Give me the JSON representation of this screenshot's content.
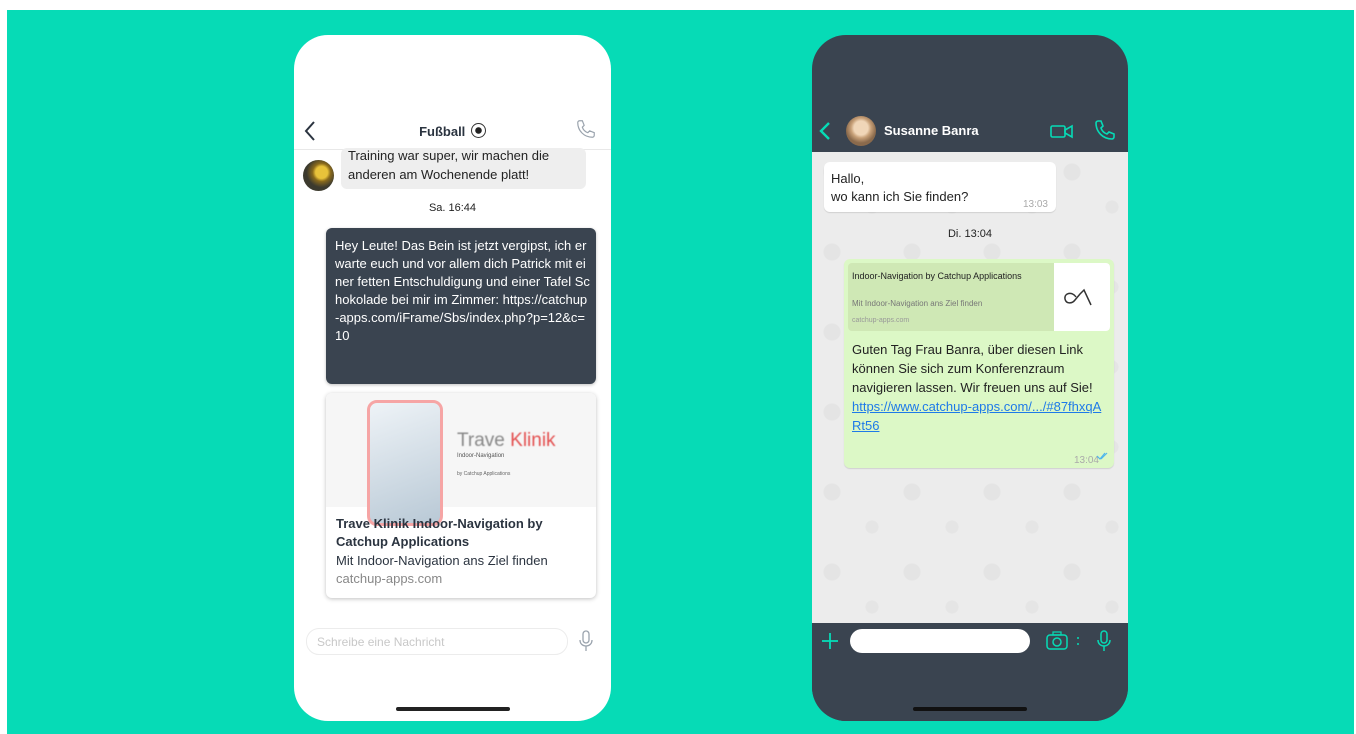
{
  "colors": {
    "background": "#06dbb6",
    "accent": "#06dbb6",
    "dark_bubble": "#3a4450",
    "link": "#1e7ae8"
  },
  "left_phone": {
    "chat_title": "Fußball",
    "incoming_message": "Training war super, wir machen die anderen am Wochenende platt!",
    "timestamp": "Sa. 16:44",
    "outgoing_message": "Hey Leute! Das Bein ist jetzt vergipst, ich erwarte euch und vor allem dich Patrick mit einer fetten Entschuldigung und einer Tafel Schokolade bei mir im Zimmer: https://catchup-apps.com/iFrame/Sbs/index.php?p=12&c=10",
    "link_card": {
      "image_brand": "Trave",
      "image_brand_accent": "Klinik",
      "image_subtitle": "Indoor-Navigation",
      "image_by": "by Catchup Applications",
      "title": "Trave Klinik Indoor-Navigation by Catchup Applications",
      "description": "Mit Indoor-Navigation ans Ziel finden",
      "url": "catchup-apps.com"
    },
    "input_placeholder": "Schreibe eine Nachricht",
    "icons": {
      "back": "chevron-left-icon",
      "call": "phone-icon",
      "mic": "microphone-icon"
    }
  },
  "right_phone": {
    "contact_name": "Susanne Banra",
    "incoming_message_line1": "Hallo,",
    "incoming_message_line2": "wo kann ich Sie finden?",
    "incoming_time": "13:03",
    "day_time": "Di. 13:04",
    "link_preview": {
      "title": "Indoor-Navigation by Catchup Applications",
      "description": "Mit Indoor-Navigation ans Ziel finden",
      "url": "catchup-apps.com"
    },
    "outgoing_message": "Guten Tag Frau Banra, über diesen Link können Sie sich zum Konferenzraum navigieren lassen. Wir freuen uns auf Sie!",
    "outgoing_link": "https://www.catchup-apps.com/.../#87fhxqARt56",
    "outgoing_time": "13:04",
    "input_value": "",
    "icons": {
      "back": "chevron-left-icon",
      "video": "video-camera-icon",
      "call": "phone-icon",
      "plus": "plus-icon",
      "camera": "camera-icon",
      "mic": "microphone-icon"
    }
  }
}
